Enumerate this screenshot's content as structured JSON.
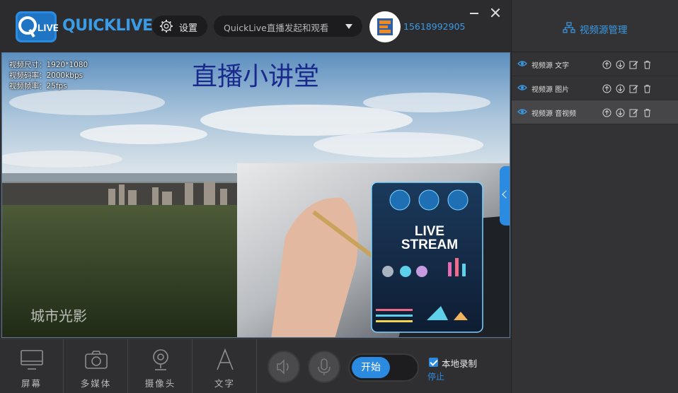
{
  "app": {
    "logo_text": "QUICKLIVE",
    "logo_badge_text": "LIVE"
  },
  "topbar": {
    "settings_label": "设置",
    "mode_value": "QuickLive直播发起和观看",
    "phone": "15618992905"
  },
  "preview": {
    "info_lines": [
      "视频尺寸：1920*1080",
      "视频码率：2000kbps",
      "视频帧率：25fps"
    ],
    "title_overlay": "直播小讲堂",
    "watermark": "城市光影",
    "inset_title_line1": "LIVE",
    "inset_title_line2": "STREAM"
  },
  "bottombar": {
    "tools": [
      {
        "label": "屏幕",
        "icon": "monitor-icon"
      },
      {
        "label": "多媒体",
        "icon": "camera-icon"
      },
      {
        "label": "摄像头",
        "icon": "webcam-icon"
      },
      {
        "label": "文字",
        "icon": "text-icon"
      }
    ],
    "start_label": "开始",
    "record_label": "本地录制",
    "record_checked": true,
    "stop_label": "停止"
  },
  "right_panel": {
    "header": "视频源管理",
    "sources": [
      {
        "name": "视频源 文字",
        "selected": false
      },
      {
        "name": "视频源 图片",
        "selected": false
      },
      {
        "name": "视频源 音视频",
        "selected": true
      }
    ]
  },
  "colors": {
    "accent": "#2b8be0",
    "brand_text": "#3a9be6",
    "title_overlay": "#1a2a8c"
  }
}
